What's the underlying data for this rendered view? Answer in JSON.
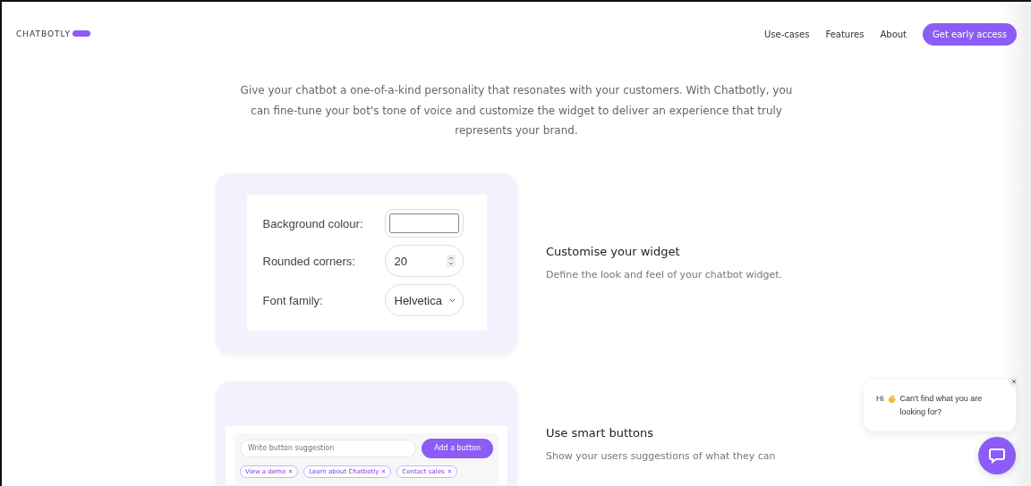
{
  "nav": {
    "logo": "CHATBOTLY",
    "links": [
      "Use-cases",
      "Features",
      "About"
    ],
    "cta": "Get early access"
  },
  "intro": "Give your chatbot a one-of-a-kind personality that resonates with your customers. With Chatbotly, you can fine-tune your bot's tone of voice and customize the widget to deliver an experience that truly represents your brand.",
  "features": [
    {
      "kind": "settings",
      "title": "Customise your widget",
      "description": "Define the look and feel of your chatbot widget.",
      "settings": [
        {
          "label": "Background colour:",
          "kind": "color"
        },
        {
          "label": "Rounded corners:",
          "kind": "number",
          "value": "20"
        },
        {
          "label": "Font family:",
          "kind": "select",
          "value": "Helvetica"
        }
      ]
    },
    {
      "kind": "buttons",
      "title": "Use smart buttons",
      "description": "Show your users suggestions of what they can",
      "input_placeholder": "Write button suggestion",
      "add_button": "Add a button",
      "chips": [
        "View a demo",
        "Learn about Chatbotly",
        "Contact sales"
      ]
    }
  ],
  "chat": {
    "greeting": "Hi",
    "message": "Can't find what you are looking for?"
  }
}
